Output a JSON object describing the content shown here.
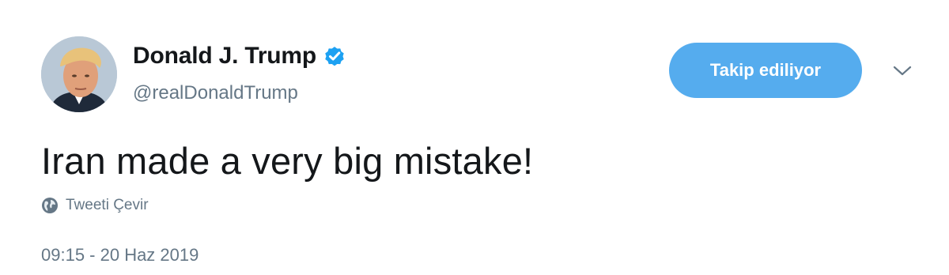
{
  "tweet": {
    "author": {
      "display_name": "Donald J. Trump",
      "handle": "@realDonaldTrump",
      "verified": true,
      "verified_color": "#1da1f2"
    },
    "follow_button_label": "Takip ediliyor",
    "follow_button_color": "#55acee",
    "text": "Iran made a very big mistake!",
    "translate_label": "Tweeti Çevir",
    "timestamp": "09:15 - 20 Haz 2019"
  }
}
